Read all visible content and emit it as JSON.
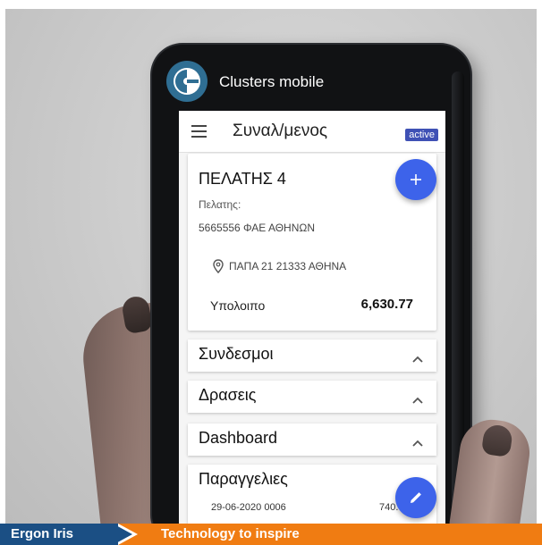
{
  "app": {
    "title": "Clusters mobile"
  },
  "appbar": {
    "title": "Συναλ/μενος",
    "status_badge": "active"
  },
  "customer": {
    "name": "ΠΕΛΑΤΗΣ 4",
    "label": "Πελατης:",
    "id_line": "5665556 ΦΑΕ ΑΘΗΝΩΝ",
    "address": "ΠΑΠΑ 21 21333 ΑΘΗΝΑ",
    "balance_label": "Υπολοιπο",
    "balance_value": "6,630.77"
  },
  "panels": [
    {
      "title": "Συνδεσμοι",
      "expanded": true
    },
    {
      "title": "Δρασεις",
      "expanded": true
    },
    {
      "title": "Dashboard",
      "expanded": true
    }
  ],
  "orders": {
    "title": "Παραγγελιες",
    "rows": [
      {
        "date": "29-06-2020 0006",
        "amount": "740.0"
      }
    ]
  },
  "banner": {
    "brand": "Ergon Iris",
    "tagline": "Technology to inspire"
  },
  "icons": {
    "menu": "menu-icon",
    "add": "add-icon",
    "edit": "edit-icon",
    "location": "location-pin-icon",
    "chevron": "chevron-up-icon"
  },
  "colors": {
    "accent": "#3d63ea",
    "badge": "#3f51b5",
    "banner_orange": "#f07c12",
    "banner_blue": "#1b4f84",
    "logo": "#2f6e93"
  }
}
